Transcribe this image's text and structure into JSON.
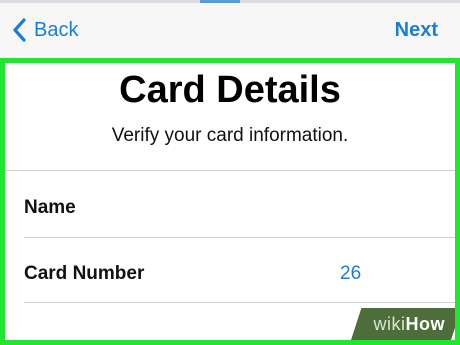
{
  "nav": {
    "back_label": "Back",
    "next_label": "Next"
  },
  "page": {
    "title": "Card Details",
    "subtitle": "Verify your card information."
  },
  "form": {
    "rows": [
      {
        "label": "Name",
        "value": ""
      },
      {
        "label": "Card Number",
        "value": "26"
      }
    ]
  },
  "watermark": {
    "prefix": "wiki",
    "suffix": "How"
  },
  "colors": {
    "accent": "#1a7fd4",
    "highlight_border": "#22e52f",
    "watermark_bg": "#4d6e3a"
  }
}
